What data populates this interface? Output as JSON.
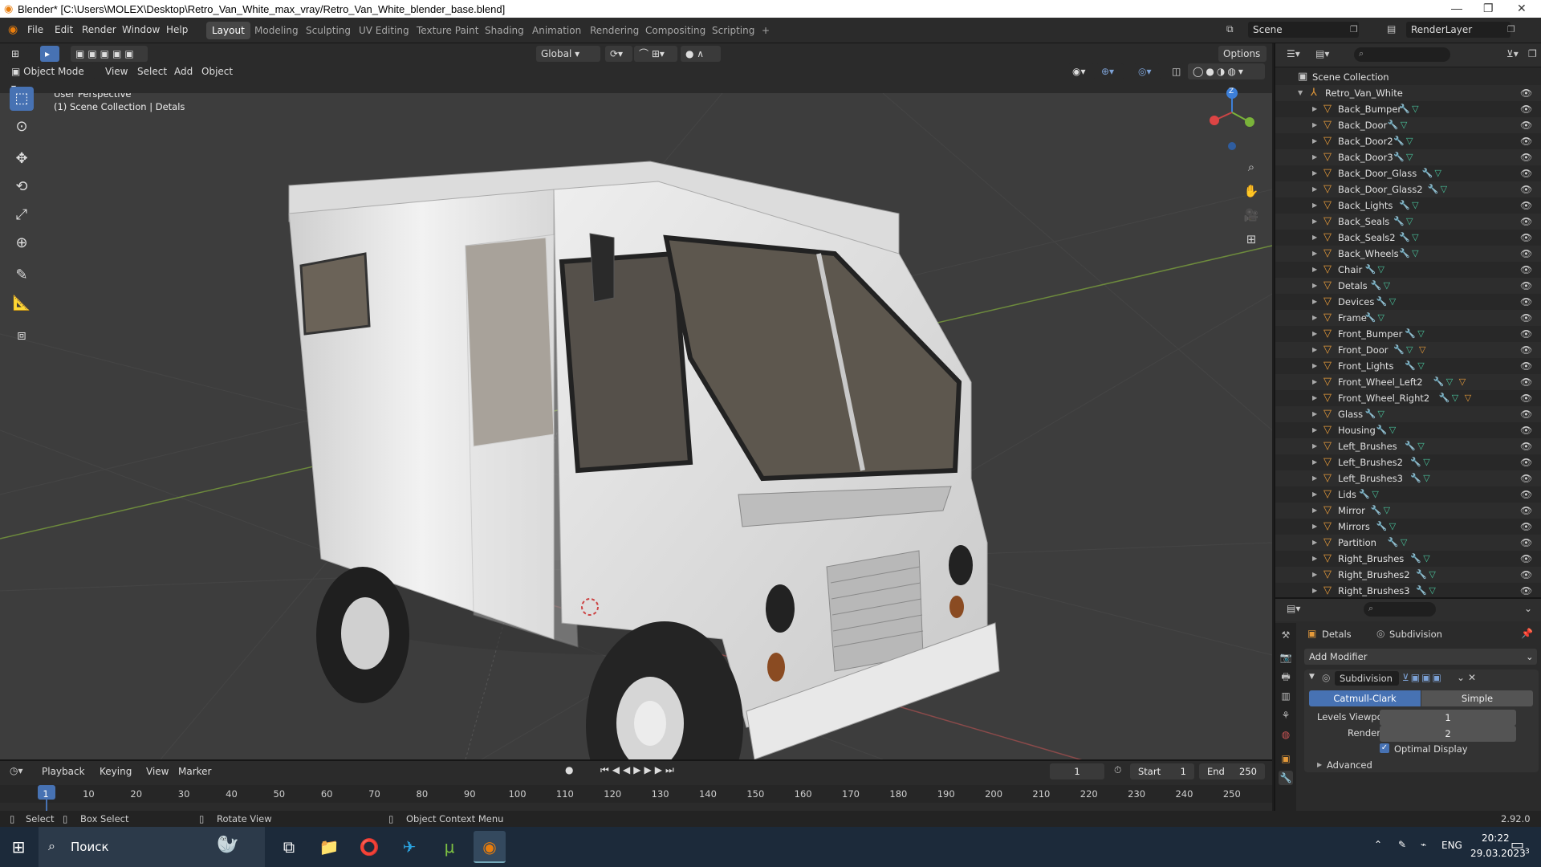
{
  "window": {
    "title": "Blender* [C:\\Users\\MOLEX\\Desktop\\Retro_Van_White_max_vray/Retro_Van_White_blender_base.blend]",
    "minimize": "—",
    "maximize": "❐",
    "close": "✕"
  },
  "menu": [
    "File",
    "Edit",
    "Render",
    "Window",
    "Help"
  ],
  "workspaces": [
    "Layout",
    "Modeling",
    "Sculpting",
    "UV Editing",
    "Texture Paint",
    "Shading",
    "Animation",
    "Rendering",
    "Compositing",
    "Scripting"
  ],
  "active_workspace": "Layout",
  "add_workspace": "+",
  "scene": {
    "label": "Scene",
    "render_layer": "RenderLayer"
  },
  "viewport_header": {
    "transform_orientation": "Global",
    "options": "Options",
    "mode": "Object Mode",
    "menus": [
      "View",
      "Select",
      "Add",
      "Object"
    ]
  },
  "viewport": {
    "line1": "User Perspective",
    "line2": "(1) Scene Collection | Detals",
    "gizmo_z": "Z"
  },
  "outliner": {
    "root": "Scene Collection",
    "collection": "Retro_Van_White",
    "items": [
      {
        "name": "Back_Bumper",
        "extra": false
      },
      {
        "name": "Back_Door",
        "extra": false
      },
      {
        "name": "Back_Door2",
        "extra": false
      },
      {
        "name": "Back_Door3",
        "extra": false
      },
      {
        "name": "Back_Door_Glass",
        "extra": false
      },
      {
        "name": "Back_Door_Glass2",
        "extra": false
      },
      {
        "name": "Back_Lights",
        "extra": false
      },
      {
        "name": "Back_Seals",
        "extra": false
      },
      {
        "name": "Back_Seals2",
        "extra": false
      },
      {
        "name": "Back_Wheels",
        "extra": false
      },
      {
        "name": "Chair",
        "extra": false
      },
      {
        "name": "Detals",
        "extra": false
      },
      {
        "name": "Devices",
        "extra": false
      },
      {
        "name": "Frame",
        "extra": false
      },
      {
        "name": "Front_Bumper",
        "extra": false
      },
      {
        "name": "Front_Door",
        "extra": true
      },
      {
        "name": "Front_Lights",
        "extra": false
      },
      {
        "name": "Front_Wheel_Left2",
        "extra": true
      },
      {
        "name": "Front_Wheel_Right2",
        "extra": true
      },
      {
        "name": "Glass",
        "extra": false
      },
      {
        "name": "Housing",
        "extra": false
      },
      {
        "name": "Left_Brushes",
        "extra": false
      },
      {
        "name": "Left_Brushes2",
        "extra": false
      },
      {
        "name": "Left_Brushes3",
        "extra": false
      },
      {
        "name": "Lids",
        "extra": false
      },
      {
        "name": "Mirror",
        "extra": false
      },
      {
        "name": "Mirrors",
        "extra": false
      },
      {
        "name": "Partition",
        "extra": false
      },
      {
        "name": "Right_Brushes",
        "extra": false
      },
      {
        "name": "Right_Brushes2",
        "extra": false
      },
      {
        "name": "Right_Brushes3",
        "extra": false
      }
    ]
  },
  "properties": {
    "object": "Detals",
    "modifier_name": "Subdivision",
    "add_modifier": "Add Modifier",
    "modifier_title": "Subdivision",
    "catmull": "Catmull-Clark",
    "simple": "Simple",
    "levels_viewport_label": "Levels Viewport",
    "levels_viewport": "1",
    "render_label": "Render",
    "render": "2",
    "optimal_display": "Optimal Display",
    "advanced": "Advanced"
  },
  "timeline": {
    "menus": [
      "Playback",
      "Keying",
      "View",
      "Marker"
    ],
    "current_frame": "1",
    "start_label": "Start",
    "start": "1",
    "end_label": "End",
    "end": "250",
    "ticks": [
      "1",
      "10",
      "20",
      "30",
      "40",
      "50",
      "60",
      "70",
      "80",
      "90",
      "100",
      "110",
      "120",
      "130",
      "140",
      "150",
      "160",
      "170",
      "180",
      "190",
      "200",
      "210",
      "220",
      "230",
      "240",
      "250"
    ]
  },
  "status": {
    "select": "Select",
    "box_select": "Box Select",
    "rotate_view": "Rotate View",
    "context_menu": "Object Context Menu",
    "version": "2.92.0"
  },
  "taskbar": {
    "search": "Поиск",
    "lang": "ENG",
    "time": "20:22",
    "date": "29.03.2023",
    "notif": "3"
  },
  "colors": {
    "accent": "#4772b3",
    "object_icon": "#e59a3a",
    "mesh_icon": "#49c29b"
  }
}
